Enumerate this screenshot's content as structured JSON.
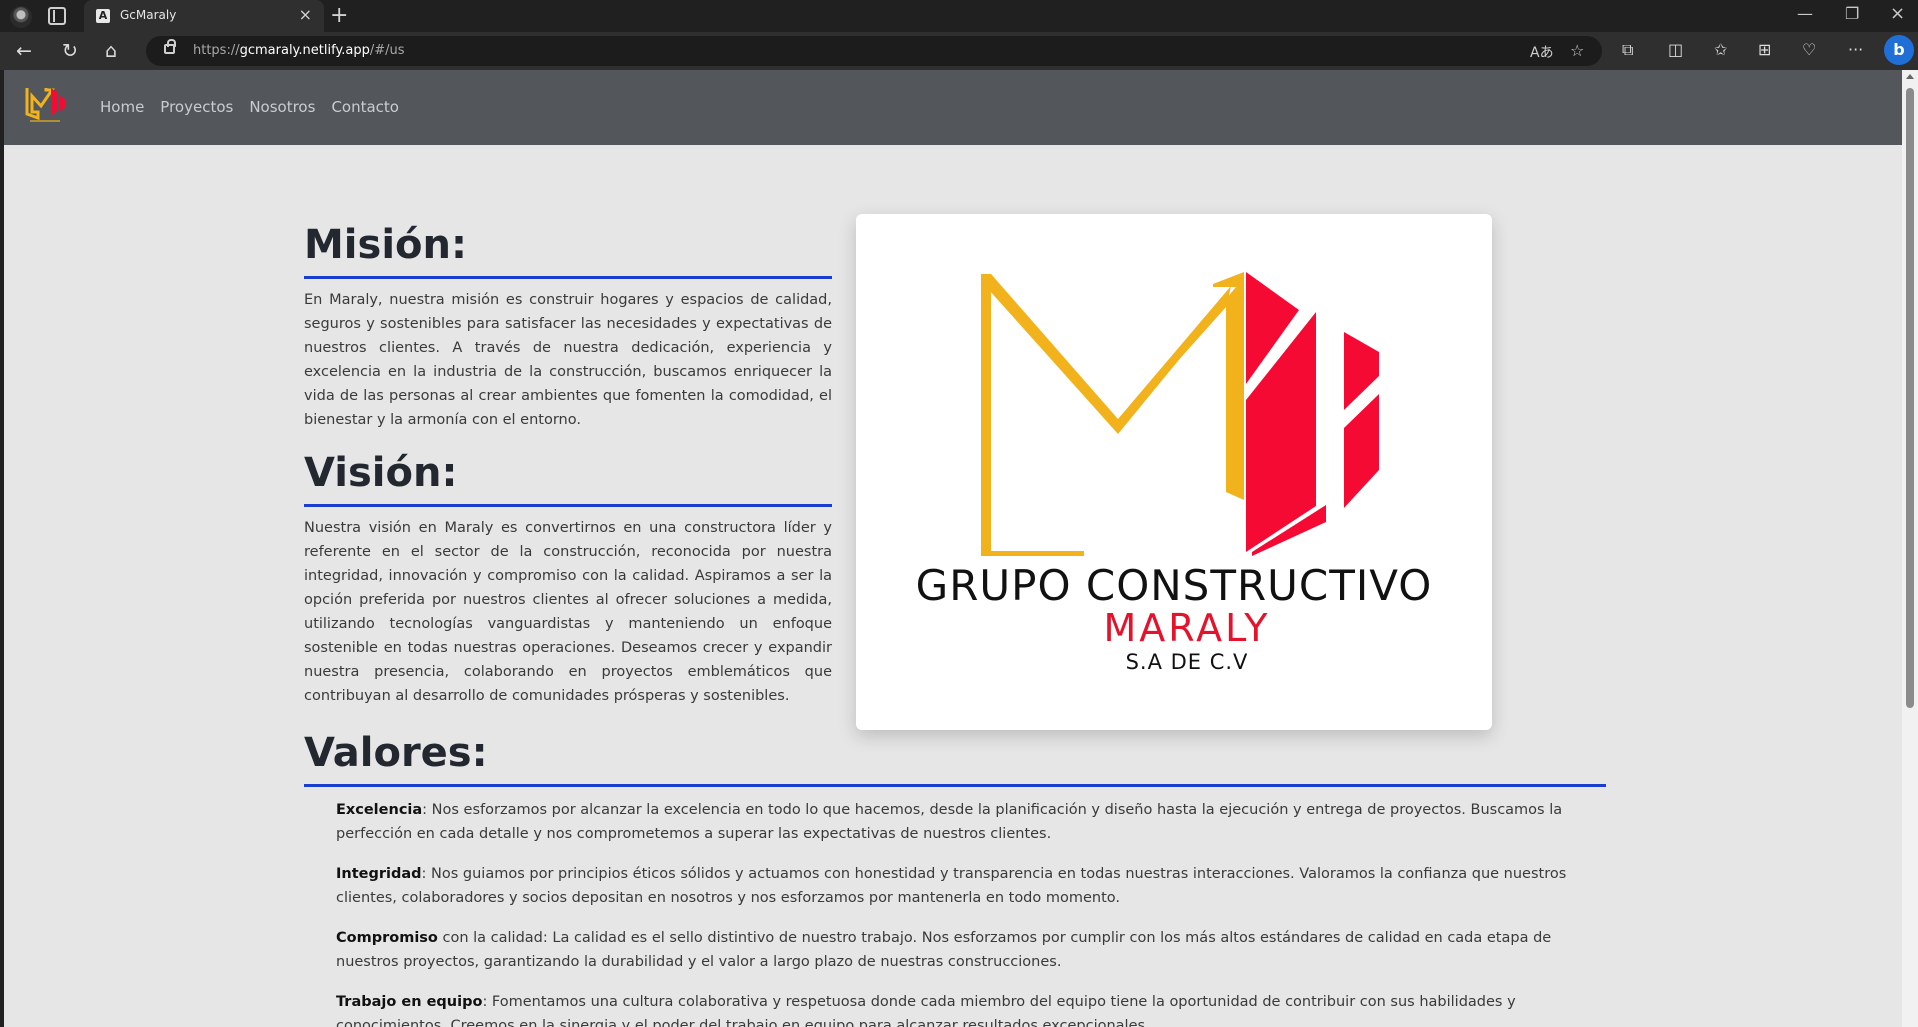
{
  "browser": {
    "tab_title": "GcMaraly",
    "tab_favicon": "A",
    "url_scheme": "https://",
    "url_host": "gcmaraly.netlify.app",
    "url_path": "/#/us"
  },
  "navbar": {
    "links": [
      "Home",
      "Proyectos",
      "Nosotros",
      "Contacto"
    ]
  },
  "mision": {
    "title": "Misión:",
    "text": "En Maraly, nuestra misión es construir hogares y espacios de calidad, seguros y sostenibles para satisfacer las necesidades y expectativas de nuestros clientes. A través de nuestra dedicación, experiencia y excelencia en la industria de la construcción, buscamos enriquecer la vida de las personas al crear ambientes que fomenten la comodidad, el bienestar y la armonía con el entorno."
  },
  "vision": {
    "title": "Visión:",
    "text": "Nuestra visión en Maraly es convertirnos en una constructora líder y referente en el sector de la construcción, reconocida por nuestra integridad, innovación y compromiso con la calidad. Aspiramos a ser la opción preferida por nuestros clientes al ofrecer soluciones a medida, utilizando tecnologías vanguardistas y manteniendo un enfoque sostenible en todas nuestras operaciones. Deseamos crecer y expandir nuestra presencia, colaborando en proyectos emblemáticos que contribuyan al desarrollo de comunidades prósperas y sostenibles."
  },
  "logo": {
    "line1": "GRUPO CONSTRUCTIVO",
    "line2": "MARALY",
    "line3": "S.A DE C.V",
    "colors": {
      "gold": "#f2b21b",
      "red": "#f50a34"
    }
  },
  "valores": {
    "title": "Valores:",
    "items": [
      {
        "term": "Excelencia",
        "text": ": Nos esforzamos por alcanzar la excelencia en todo lo que hacemos, desde la planificación y diseño hasta la ejecución y entrega de proyectos. Buscamos la perfección en cada detalle y nos comprometemos a superar las expectativas de nuestros clientes."
      },
      {
        "term": "Integridad",
        "text": ": Nos guiamos por principios éticos sólidos y actuamos con honestidad y transparencia en todas nuestras interacciones. Valoramos la confianza que nuestros clientes, colaboradores y socios depositan en nosotros y nos esforzamos por mantenerla en todo momento."
      },
      {
        "term": "Compromiso",
        "text": " con la calidad: La calidad es el sello distintivo de nuestro trabajo. Nos esforzamos por cumplir con los más altos estándares de calidad en cada etapa de nuestros proyectos, garantizando la durabilidad y el valor a largo plazo de nuestras construcciones."
      },
      {
        "term": "Trabajo en equipo",
        "text": ": Fomentamos una cultura colaborativa y respetuosa donde cada miembro del equipo tiene la oportunidad de contribuir con sus habilidades y conocimientos. Creemos en la sinergia y el poder del trabajo en equipo para alcanzar resultados excepcionales."
      }
    ]
  },
  "theme": {
    "accent_rule": "#1a3ccf",
    "navbar_bg": "#53575c",
    "page_bg": "#e6e6e6"
  }
}
